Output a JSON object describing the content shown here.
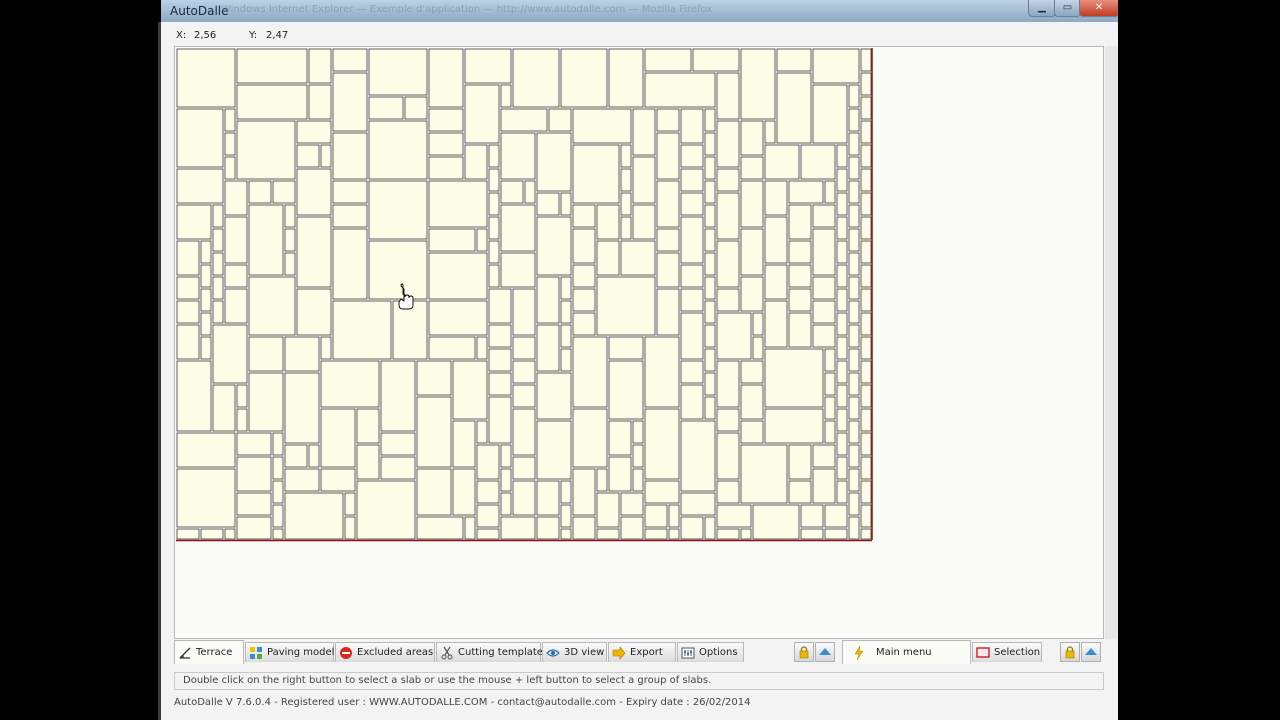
{
  "window": {
    "title": "AutoDalle",
    "background_title": "Windows Internet Explorer — Exemple d'application — http://www.autodalle.com — Mozilla Firefox"
  },
  "coords": {
    "x_label": "X:",
    "x_value": "2,56",
    "y_label": "Y:",
    "y_value": "2,47"
  },
  "tabs": [
    {
      "label": "Terrace",
      "icon": "terrace-icon",
      "active": true
    },
    {
      "label": "Paving model",
      "icon": "paving-model-icon",
      "active": false
    },
    {
      "label": "Excluded areas",
      "icon": "no-entry-icon",
      "active": false
    },
    {
      "label": "Cutting template",
      "icon": "scissors-icon",
      "active": false
    },
    {
      "label": "3D view",
      "icon": "eye-icon",
      "active": false
    },
    {
      "label": "Export",
      "icon": "export-arrow-icon",
      "active": false
    },
    {
      "label": "Options",
      "icon": "options-icon",
      "active": false
    }
  ],
  "right_tabs": [
    {
      "label": "Main menu",
      "icon": "lightning-icon",
      "active": true
    },
    {
      "label": "Selection",
      "icon": "selection-icon",
      "active": false
    }
  ],
  "help_text": "Double click on the right button to select a slab or use the mouse + left button to select a group of slabs.",
  "status_text": "AutoDalle  V 7.6.0.4 - Registered user :  WWW.AUTODALLE.COM - contact@autodalle.com - Expiry date : 26/02/2014",
  "colors": {
    "slab_fill": "#fdfce7",
    "slab_stroke": "#3a3a3a",
    "terrace_edge": "#8b1010",
    "workspace_bg": "#fbfbf8"
  }
}
